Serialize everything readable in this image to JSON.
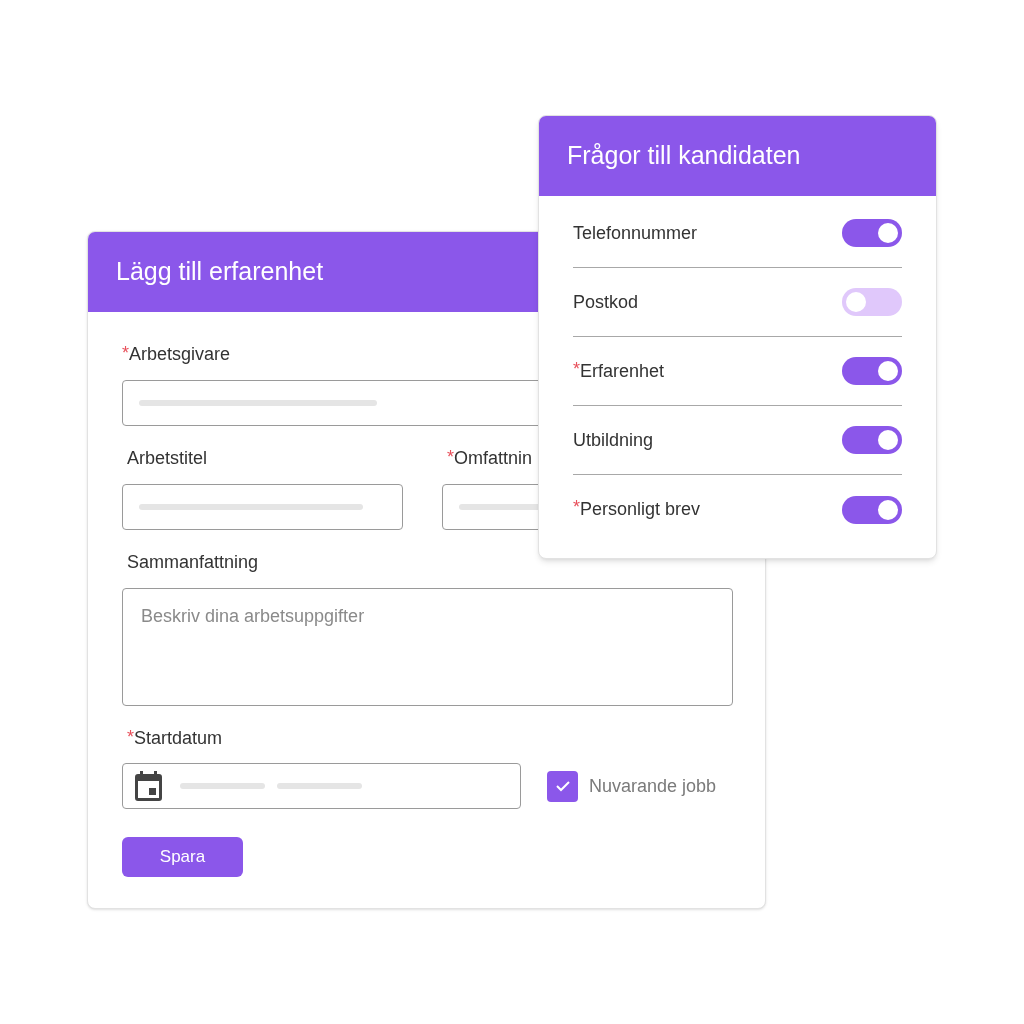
{
  "experience_form": {
    "title": "Lägg till erfarenhet",
    "employer": {
      "marker": "*",
      "label": "Arbetsgivare"
    },
    "job_title": {
      "label": "Arbetstitel"
    },
    "extent": {
      "marker": "*",
      "label": "Omfattnin"
    },
    "summary": {
      "label": "Sammanfattning",
      "placeholder": "Beskriv dina arbetsuppgifter"
    },
    "start_date": {
      "marker": "*",
      "label": "Startdatum"
    },
    "current_job": {
      "label": "Nuvarande jobb",
      "checked": true
    },
    "save_button": "Spara"
  },
  "candidate_questions": {
    "title": "Frågor till kandidaten",
    "questions": [
      {
        "label": "Telefonnummer",
        "on": true
      },
      {
        "label": "Postkod",
        "on": false
      },
      {
        "marker": "*",
        "label": "Erfarenhet",
        "on": true
      },
      {
        "label": "Utbildning",
        "on": true
      },
      {
        "marker": "*",
        "label": "Personligt brev",
        "on": true
      }
    ]
  }
}
